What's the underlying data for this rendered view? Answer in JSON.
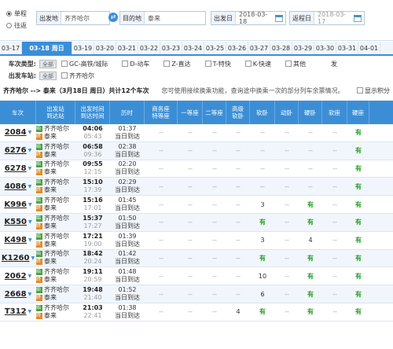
{
  "search": {
    "oneway": "单程",
    "roundtrip": "往返",
    "from_label": "出发地",
    "from_value": "齐齐哈尔",
    "to_label": "目的地",
    "to_value": "泰来",
    "date_label": "出发日",
    "date_value": "2018-03-18",
    "return_label": "返程日",
    "return_value": "2018-03-17"
  },
  "dates": [
    "03-17",
    "03-18 周日",
    "03-19",
    "03-20",
    "03-21",
    "03-22",
    "03-23",
    "03-24",
    "03-25",
    "03-26",
    "03-27",
    "03-28",
    "03-29",
    "03-30",
    "03-31",
    "04-01"
  ],
  "filter": {
    "type_label": "车次类型:",
    "all": "全部",
    "types": [
      "GC-高铁/城际",
      "D-动车",
      "Z-直达",
      "T-特快",
      "K-快速",
      "其他"
    ],
    "station_label": "出发车站:",
    "station": "齐齐哈尔",
    "tail": "发"
  },
  "route": {
    "text": "齐齐哈尔 --> 泰来（3月18日 周日）共计12个车次",
    "tip": "您可使用接续换乘功能，查询途中换乘一次的部分列车余票情况。",
    "option": "显示积分"
  },
  "columns": [
    "车次",
    "出发站\n到达站",
    "出发时间\n到达时间",
    "历时",
    "商务座\n特等座",
    "一等座",
    "二等座",
    "高级\n软卧",
    "软卧",
    "动卧",
    "硬卧",
    "软座",
    "硬座"
  ],
  "trains": [
    {
      "no": "2084",
      "from": "齐齐哈尔",
      "to": "泰来",
      "dep": "04:06",
      "arr": "05:43",
      "dur": "01:37",
      "day": "当日到达",
      "c": [
        "--",
        "--",
        "--",
        "--",
        "--",
        "--",
        "--",
        "--",
        "有"
      ]
    },
    {
      "no": "6276",
      "from": "齐齐哈尔",
      "to": "泰来",
      "dep": "06:58",
      "arr": "09:36",
      "dur": "02:38",
      "day": "当日到达",
      "c": [
        "--",
        "--",
        "--",
        "--",
        "--",
        "--",
        "--",
        "--",
        "有"
      ]
    },
    {
      "no": "6278",
      "from": "齐齐哈尔",
      "to": "泰来",
      "dep": "09:55",
      "arr": "12:15",
      "dur": "02:20",
      "day": "当日到达",
      "c": [
        "--",
        "--",
        "--",
        "--",
        "--",
        "--",
        "--",
        "--",
        "有"
      ]
    },
    {
      "no": "4086",
      "from": "齐齐哈尔",
      "to": "泰来",
      "dep": "15:10",
      "arr": "17:39",
      "dur": "02:29",
      "day": "当日到达",
      "c": [
        "--",
        "--",
        "--",
        "--",
        "--",
        "--",
        "--",
        "--",
        "有"
      ]
    },
    {
      "no": "K996",
      "from": "齐齐哈尔",
      "to": "泰来",
      "dep": "15:16",
      "arr": "17:01",
      "dur": "01:45",
      "day": "当日到达",
      "c": [
        "--",
        "--",
        "--",
        "--",
        "3",
        "--",
        "有",
        "--",
        "有"
      ]
    },
    {
      "no": "K550",
      "from": "齐齐哈尔",
      "to": "泰来",
      "dep": "15:37",
      "arr": "17:27",
      "dur": "01:50",
      "day": "当日到达",
      "c": [
        "--",
        "--",
        "--",
        "--",
        "有",
        "--",
        "有",
        "--",
        "有"
      ]
    },
    {
      "no": "K498",
      "from": "齐齐哈尔",
      "to": "泰来",
      "dep": "17:21",
      "arr": "19:00",
      "dur": "01:39",
      "day": "当日到达",
      "c": [
        "--",
        "--",
        "--",
        "--",
        "3",
        "--",
        "4",
        "--",
        "有"
      ]
    },
    {
      "no": "K1260",
      "from": "齐齐哈尔",
      "to": "泰来",
      "dep": "18:42",
      "arr": "20:24",
      "dur": "01:42",
      "day": "当日到达",
      "c": [
        "--",
        "--",
        "--",
        "--",
        "有",
        "--",
        "有",
        "--",
        "有"
      ]
    },
    {
      "no": "2062",
      "from": "齐齐哈尔",
      "to": "泰来",
      "dep": "19:11",
      "arr": "20:59",
      "dur": "01:48",
      "day": "当日到达",
      "c": [
        "--",
        "--",
        "--",
        "--",
        "10",
        "--",
        "有",
        "--",
        "有"
      ]
    },
    {
      "no": "2668",
      "from": "齐齐哈尔",
      "to": "泰来",
      "dep": "19:48",
      "arr": "21:40",
      "dur": "01:52",
      "day": "当日到达",
      "c": [
        "--",
        "--",
        "--",
        "--",
        "6",
        "--",
        "有",
        "--",
        "有"
      ]
    },
    {
      "no": "T312",
      "from": "齐齐哈尔",
      "to": "泰来",
      "dep": "21:03",
      "arr": "22:41",
      "dur": "01:38",
      "day": "当日到达",
      "c": [
        "--",
        "--",
        "--",
        "4",
        "有",
        "--",
        "有",
        "--",
        "有"
      ]
    }
  ],
  "colors": {
    "accent": "#3b8ed6",
    "available": "#27a127"
  }
}
